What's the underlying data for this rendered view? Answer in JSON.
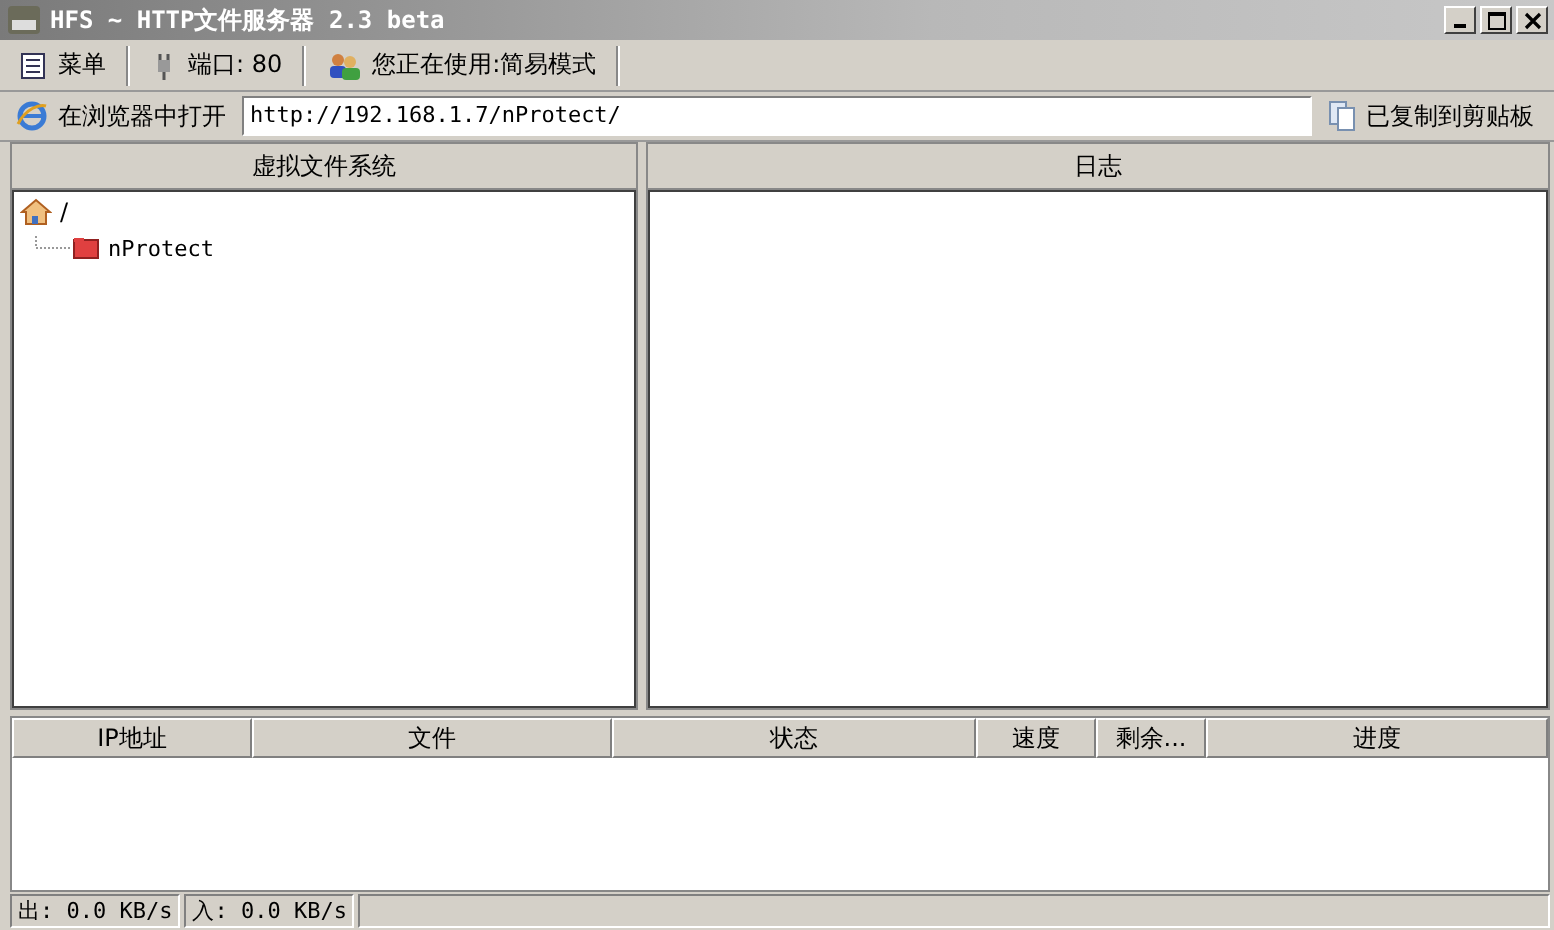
{
  "window": {
    "title": "HFS ~ HTTP文件服务器 2.3 beta"
  },
  "toolbar": [
    {
      "kind": "menu",
      "label": "菜单"
    },
    {
      "kind": "port",
      "label": "端口: 80"
    },
    {
      "kind": "mode",
      "label": "您正在使用:简易模式"
    }
  ],
  "address_bar": {
    "open_label": "在浏览器中打开",
    "url": "http://192.168.1.7/nProtect/",
    "copy_label": "已复制到剪贴板"
  },
  "vfs": {
    "title": "虚拟文件系统",
    "tree": [
      {
        "label": "/",
        "kind": "root",
        "children": [
          {
            "label": "nProtect",
            "kind": "folder"
          }
        ]
      }
    ]
  },
  "log": {
    "title": "日志"
  },
  "connections": {
    "columns": [
      "IP地址",
      "文件",
      "状态",
      "速度",
      "剩余...",
      "进度"
    ]
  },
  "status_bar": [
    "出: 0.0 KB/s",
    "入: 0.0 KB/s"
  ]
}
